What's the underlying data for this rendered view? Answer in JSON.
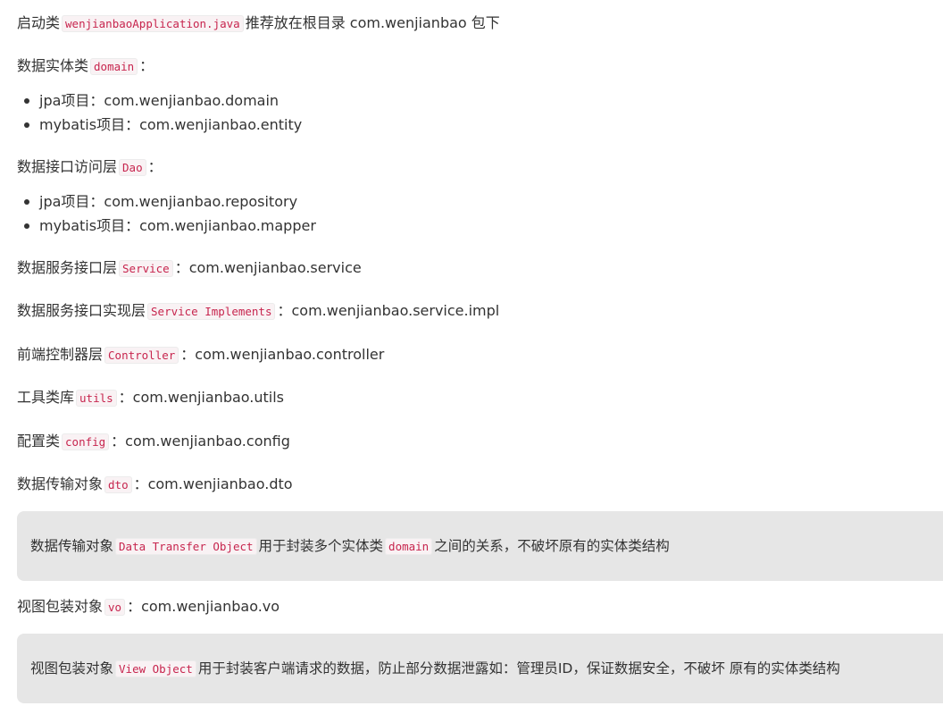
{
  "startup": {
    "prefix": "启动类",
    "code": "wenjianbaoApplication.java",
    "suffix": "推荐放在根目录 com.wenjianbao 包下"
  },
  "entity": {
    "prefix": "数据实体类",
    "code": "domain",
    "suffix": "：",
    "items": [
      "jpa项目：com.wenjianbao.domain",
      "mybatis项目：com.wenjianbao.entity"
    ]
  },
  "dao": {
    "prefix": "数据接口访问层",
    "code": "Dao",
    "suffix": "：",
    "items": [
      "jpa项目：com.wenjianbao.repository",
      "mybatis项目：com.wenjianbao.mapper"
    ]
  },
  "service": {
    "prefix": "数据服务接口层",
    "code": "Service",
    "suffix": "：com.wenjianbao.service"
  },
  "service_impl": {
    "prefix": "数据服务接口实现层",
    "code": "Service Implements",
    "suffix": "：com.wenjianbao.service.impl"
  },
  "controller": {
    "prefix": "前端控制器层",
    "code": "Controller",
    "suffix": "：com.wenjianbao.controller"
  },
  "utils": {
    "prefix": "工具类库",
    "code": "utils",
    "suffix": "：com.wenjianbao.utils"
  },
  "config": {
    "prefix": "配置类",
    "code": "config",
    "suffix": "：com.wenjianbao.config"
  },
  "dto": {
    "prefix": "数据传输对象",
    "code": "dto",
    "suffix": "：com.wenjianbao.dto",
    "quote": {
      "prefix": "数据传输对象",
      "code1": "Data Transfer Object",
      "middle": "用于封装多个实体类",
      "code2": "domain",
      "suffix": "之间的关系，不破坏原有的实体类结构"
    }
  },
  "vo": {
    "prefix": "视图包装对象",
    "code": "vo",
    "suffix": "：com.wenjianbao.vo",
    "quote": {
      "prefix": "视图包装对象",
      "code": "View Object",
      "suffix": "用于封装客户端请求的数据，防止部分数据泄露如：管理员ID，保证数据安全，不破坏 原有的实体类结构"
    }
  }
}
